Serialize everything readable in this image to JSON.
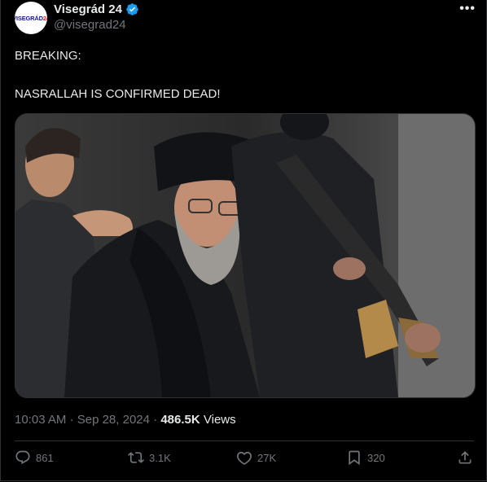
{
  "account": {
    "avatar_text_blue": "VISEGRÁD",
    "avatar_text_red": "24",
    "name": "Visegrád 24",
    "handle": "@visegrad24"
  },
  "menu": {
    "more_icon": "more-icon"
  },
  "tweet": {
    "line1": "BREAKING:",
    "line2": "NASRALLAH IS CONFIRMED DEAD!"
  },
  "meta": {
    "time": "10:03 AM",
    "date": "Sep 28, 2024",
    "views_count": "486.5K",
    "views_label": "Views"
  },
  "actions": {
    "replies": "861",
    "reposts": "3.1K",
    "likes": "27K",
    "bookmarks": "320"
  },
  "colors": {
    "background": "#000000",
    "text": "#e7e9ea",
    "muted": "#71767b",
    "verified": "#1d9bf0",
    "border": "#2f3336"
  }
}
